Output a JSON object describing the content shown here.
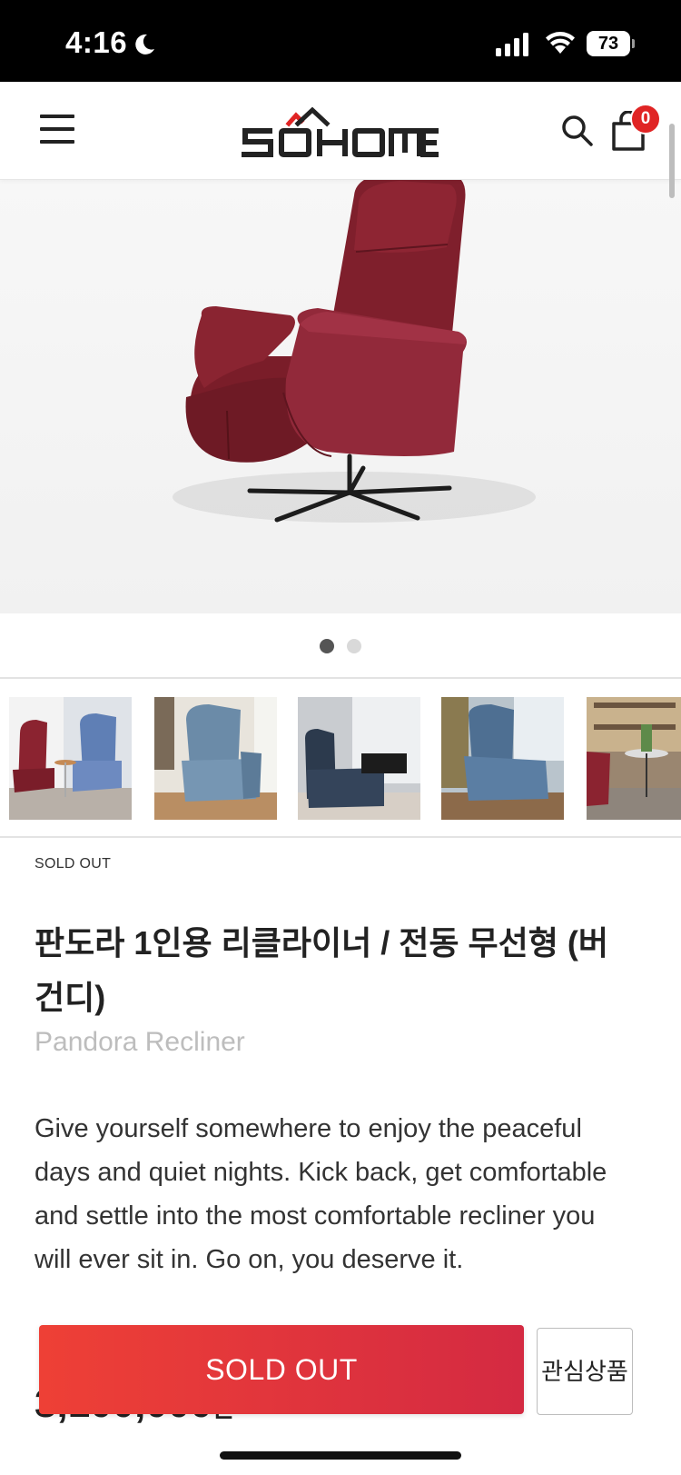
{
  "status_bar": {
    "time": "4:16",
    "battery": "73",
    "icons": [
      "moon-icon",
      "signal-icon",
      "wifi-icon",
      "battery-icon"
    ]
  },
  "header": {
    "logo_text": "SOHOME",
    "cart_count": "0",
    "icons": [
      "menu-icon",
      "search-icon",
      "cart-icon"
    ]
  },
  "colors": {
    "accent": "#e02424",
    "button_gradient_start": "#ee4036",
    "button_gradient_end": "#d42a42",
    "chair": "#8b2330"
  },
  "carousel": {
    "slide_count": 2,
    "active_index": 0
  },
  "product": {
    "status_label": "SOLD OUT",
    "title": "판도라 1인용 리클라이너 / 전동 무선형 (버건디)",
    "subtitle": "Pandora Recliner",
    "description": "Give yourself somewhere to enjoy the peaceful days and quiet nights. Kick back, get comfortable and settle into the most comfortable recliner you will ever sit in. Go on, you deserve it.",
    "price": "3,100,000",
    "currency": "원"
  },
  "actions": {
    "soldout_label": "SOLD OUT",
    "wishlist_label": "관심상품"
  }
}
